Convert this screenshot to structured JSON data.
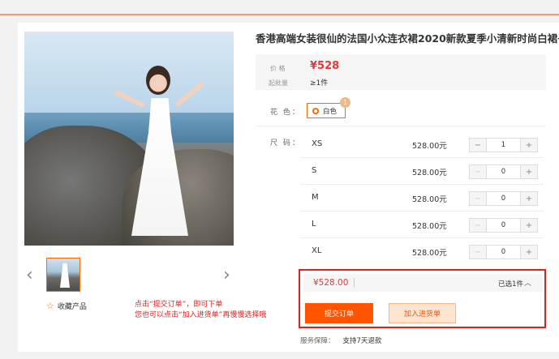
{
  "product": {
    "title": "香港高端女装很仙的法国小众连衣裙2020新款夏季小清新时尚白裙子",
    "favorite_label": "收藏产品"
  },
  "price_panel": {
    "price_label": "价 格",
    "price": "¥528",
    "moq_label": "起批量",
    "moq": "≥1件"
  },
  "color": {
    "label": "花 色：",
    "options": [
      {
        "label": "白色",
        "badge": "1"
      }
    ]
  },
  "sizes": {
    "label": "尺 码：",
    "rows": [
      {
        "name": "XS",
        "price": "528.00元",
        "qty": "1"
      },
      {
        "name": "S",
        "price": "528.00元",
        "qty": "0"
      },
      {
        "name": "M",
        "price": "528.00元",
        "qty": "0"
      },
      {
        "name": "L",
        "price": "528.00元",
        "qty": "0"
      },
      {
        "name": "XL",
        "price": "528.00元",
        "qty": "0"
      }
    ],
    "minus": "−",
    "plus": "+"
  },
  "order": {
    "total": "¥528.00",
    "selected": "已选1件",
    "chevron": "︿",
    "submit_label": "提交订单",
    "cart_label": "加入进货单"
  },
  "annotation": {
    "line1": "点击“提交订单”，即可下单",
    "line2": "您也可以点击“加入进货单”再慢慢选择哦"
  },
  "service": {
    "label": "服务保障：",
    "value": "支持7天退款"
  },
  "gallery": {
    "prev": "‹",
    "next": "›"
  },
  "colors": {
    "accent": "#ff5500",
    "price": "#e4393c",
    "annotation": "#e02020"
  }
}
